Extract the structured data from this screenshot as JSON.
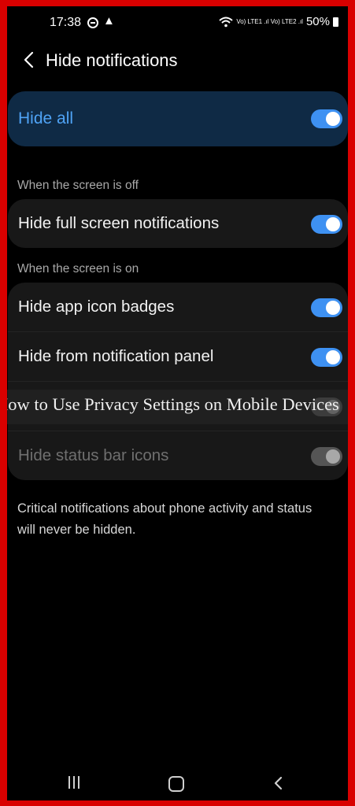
{
  "status_bar": {
    "time": "17:38",
    "signal_text": "Vo) LTE1 .ıl Vo) LTE2 .ıl",
    "battery": "50%"
  },
  "header": {
    "title": "Hide notifications"
  },
  "hide_all": {
    "label": "Hide all",
    "enabled": true
  },
  "sections": {
    "screen_off_label": "When the screen is off",
    "screen_on_label": "When the screen is on"
  },
  "settings": {
    "hide_full_screen": {
      "label": "Hide full screen notifications",
      "enabled": true
    },
    "hide_badges": {
      "label": "Hide app icon badges",
      "enabled": true
    },
    "hide_panel": {
      "label": "Hide from notification panel",
      "enabled": true
    },
    "hide_status_bar": {
      "label": "Hide status bar icons",
      "enabled": true,
      "disabled": true
    }
  },
  "footnote": "Critical notifications about phone activity and status will never be hidden.",
  "watermark": "How to Use Privacy Settings on Mobile Devices",
  "colors": {
    "accent": "#3e91f2",
    "frame_border": "#d90000",
    "highlight_card": "#0f2a45"
  }
}
